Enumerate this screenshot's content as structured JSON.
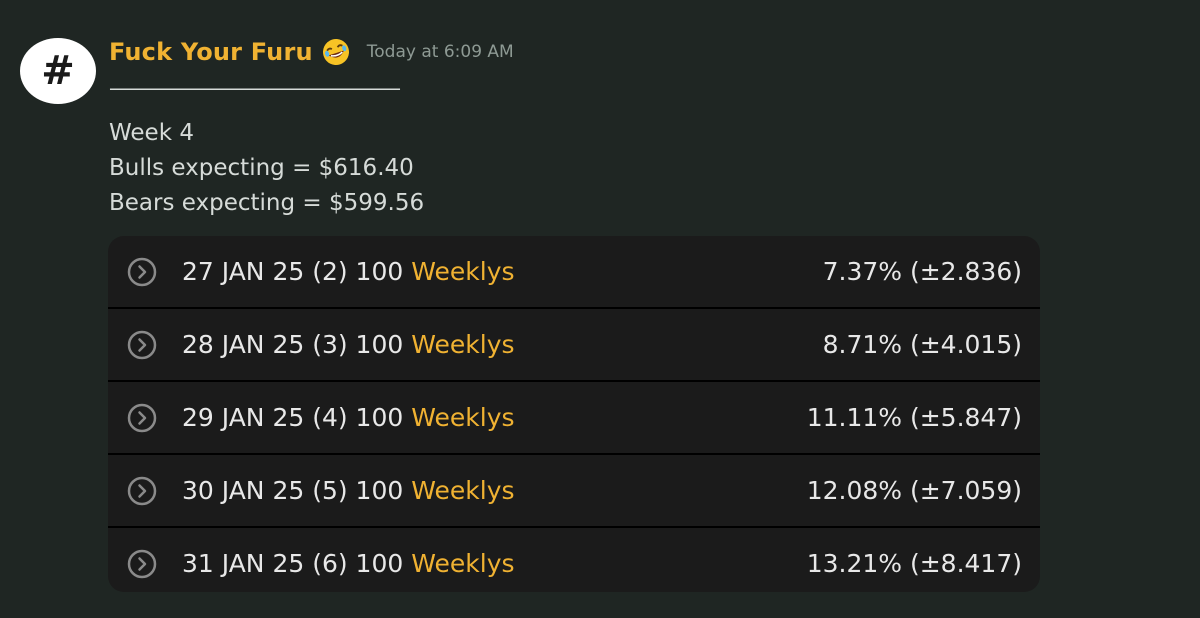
{
  "message": {
    "author": "Fuck Your Furu",
    "author_emoji": "rofl-emoji",
    "timestamp": "Today at 6:09 AM",
    "divider": "—————————————————",
    "lines": [
      "Week 4",
      "Bulls expecting = $616.40",
      "Bears expecting = $599.56"
    ]
  },
  "avatar": {
    "glyph": "#"
  },
  "options_table": {
    "weeklys_label": "Weeklys",
    "rows": [
      {
        "date": "27 JAN 25 (2) 100",
        "value": "7.37% (±2.836)"
      },
      {
        "date": "28 JAN 25 (3) 100",
        "value": "8.71% (±4.015)"
      },
      {
        "date": "29 JAN 25 (4) 100",
        "value": "11.11% (±5.847)"
      },
      {
        "date": "30 JAN 25 (5) 100",
        "value": "12.08% (±7.059)"
      },
      {
        "date": "31 JAN 25 (6) 100",
        "value": "13.21% (±8.417)"
      }
    ]
  },
  "colors": {
    "background": "#1f2623",
    "author": "#f0b232",
    "weeklys": "#f0b232",
    "card": "#1b1b1b",
    "text": "#d6dbd8"
  }
}
